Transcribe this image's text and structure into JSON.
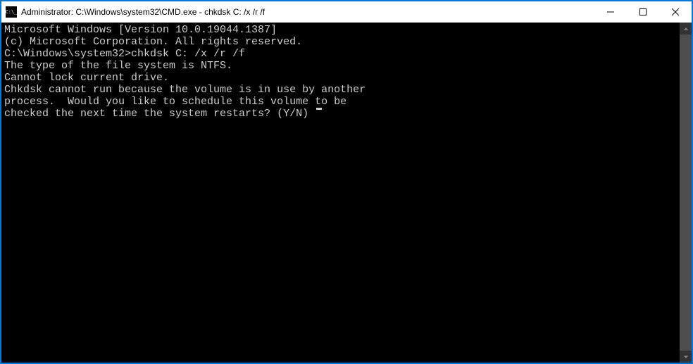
{
  "titlebar": {
    "title": "Administrator: C:\\Windows\\system32\\CMD.exe - chkdsk  C: /x /r /f"
  },
  "console": {
    "lines": [
      "Microsoft Windows [Version 10.0.19044.1387]",
      "(c) Microsoft Corporation. All rights reserved.",
      "",
      "C:\\Windows\\system32>chkdsk C: /x /r /f",
      "The type of the file system is NTFS.",
      "Cannot lock current drive.",
      "",
      "Chkdsk cannot run because the volume is in use by another",
      "process.  Would you like to schedule this volume to be",
      "checked the next time the system restarts? (Y/N) "
    ]
  }
}
